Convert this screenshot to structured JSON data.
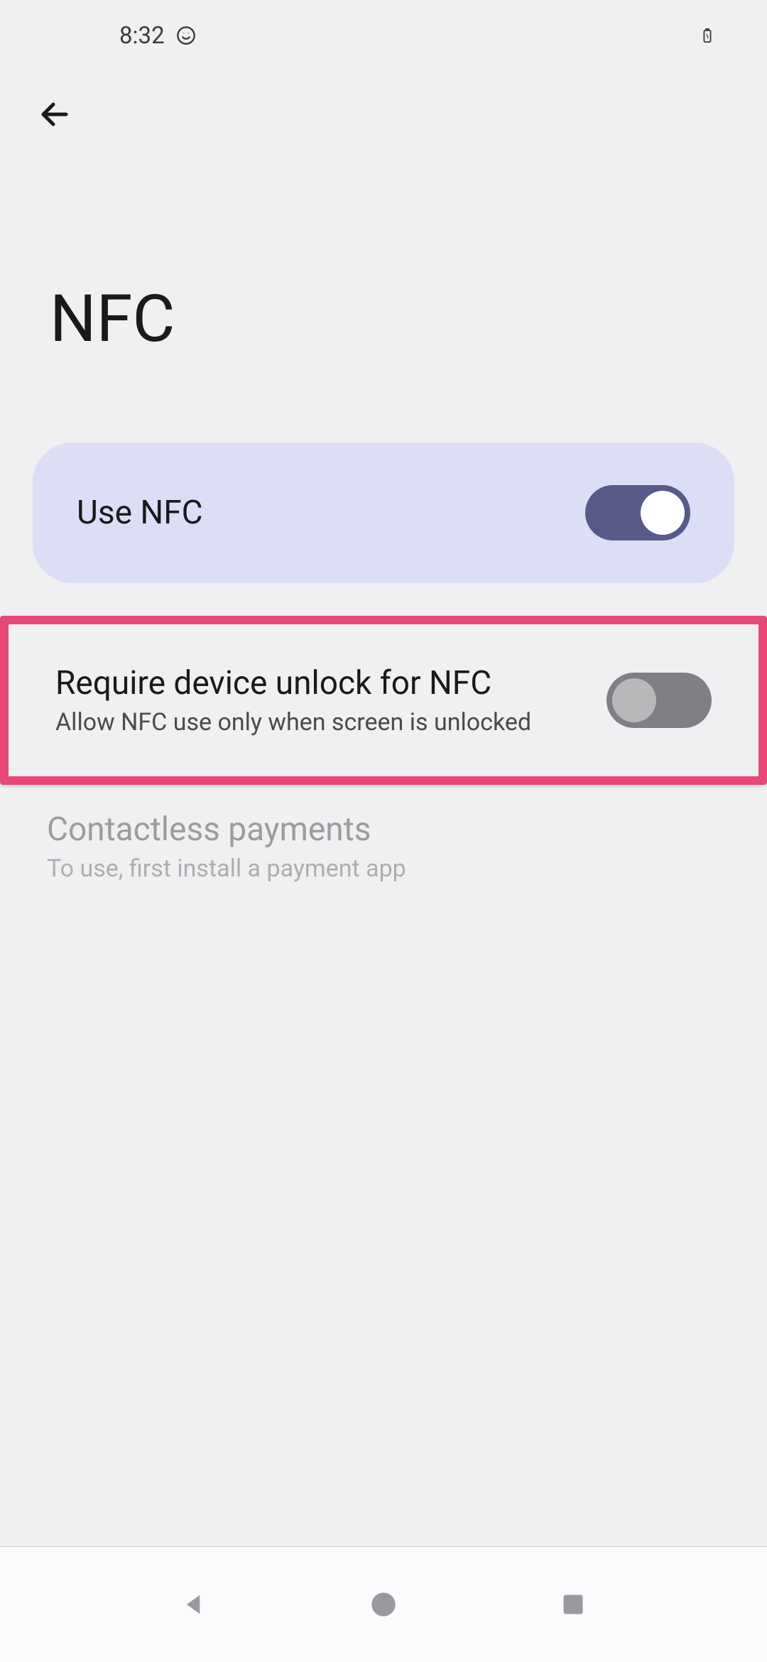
{
  "status": {
    "time": "8:32"
  },
  "header": {
    "title": "NFC"
  },
  "settings": {
    "useNfc": {
      "label": "Use NFC",
      "enabled": true
    },
    "requireUnlock": {
      "label": "Require device unlock for NFC",
      "subtitle": "Allow NFC use only when screen is unlocked",
      "enabled": false
    },
    "contactlessPayments": {
      "label": "Contactless payments",
      "subtitle": "To use, first install a payment app"
    }
  }
}
